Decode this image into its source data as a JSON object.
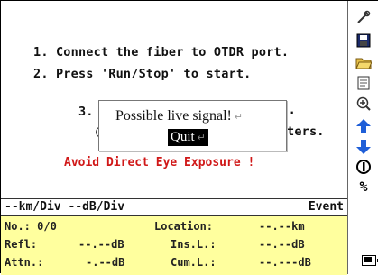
{
  "instructions": [
    "1. Connect the fiber to OTDR port.",
    "2. Press 'Run/Stop' to start.",
    "3. ",
    "or",
    "le.",
    "ters."
  ],
  "warning": "Avoid Direct Eye Exposure !",
  "dialog": {
    "message": "Possible live signal!",
    "return_mark": "↵",
    "quit_label": "Quit"
  },
  "toolbar": [
    {
      "name": "tools-icon",
      "glyph": "✎"
    },
    {
      "name": "save-icon",
      "glyph": "▣"
    },
    {
      "name": "open-folder-icon",
      "glyph": "📂"
    },
    {
      "name": "report-icon",
      "glyph": "▤"
    },
    {
      "name": "zoom-icon",
      "glyph": "⊕"
    },
    {
      "name": "up-arrow-icon",
      "glyph": "⬆"
    },
    {
      "name": "down-arrow-icon",
      "glyph": "⬇"
    },
    {
      "name": "info-icon",
      "glyph": "ⓘ"
    },
    {
      "name": "percent-icon",
      "glyph": "%"
    }
  ],
  "scale_bar": {
    "left": "--km/Div --dB/Div",
    "right": "Event"
  },
  "info": {
    "no": "No.: 0/0",
    "location_label": "Location:",
    "location_value": "--.--km",
    "refl_label": "Refl:",
    "refl_value": "--.--dB",
    "insl_label": "Ins.L.:",
    "insl_value": "--.--dB",
    "attn_label": "Attn.:",
    "attn_value": "-.--dB",
    "cuml_label": "Cum.L.:",
    "cuml_value": "--.---dB"
  },
  "colors": {
    "warning": "#d01818",
    "info_bg": "#ffff9e",
    "arrow_blue": "#1f5fd8"
  }
}
